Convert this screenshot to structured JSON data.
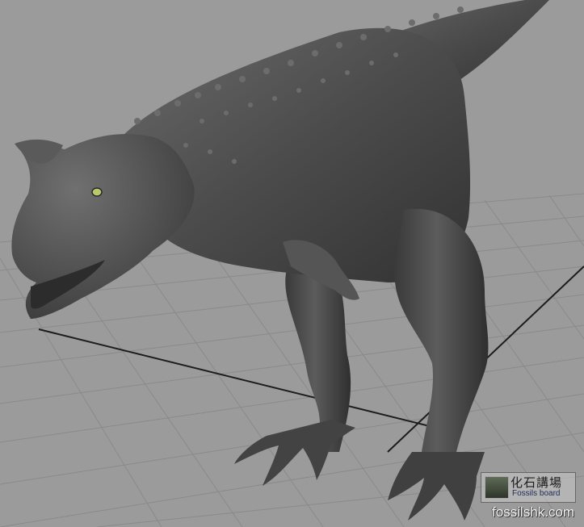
{
  "watermark": {
    "chinese": "化石講場",
    "english": "Fossils board",
    "site": "fossilshk.com"
  },
  "colors": {
    "background": "#9b9b9b",
    "grid_line": "#8a8a8a",
    "axis_line": "#1c1c1c",
    "model_body": "#4d4d4d",
    "eye": "#b8c86a"
  },
  "scene": {
    "subject": "carnotaurus-3d-model",
    "grid": true
  }
}
